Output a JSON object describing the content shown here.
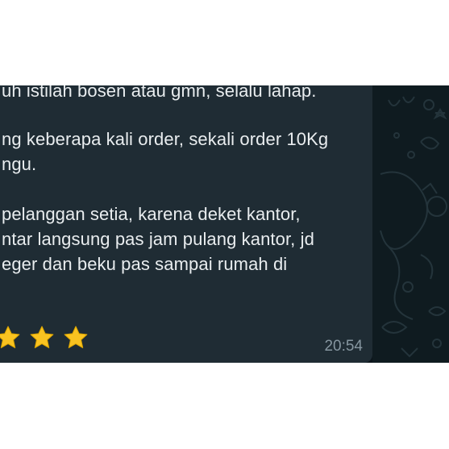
{
  "colors": {
    "bubble_bg": "#1f2c34",
    "chat_bg": "#0b141a",
    "text": "#e9edef",
    "timestamp": "#8696a0",
    "star": "#f9c321"
  },
  "message": {
    "lines": [
      "uh istilah bosen atau gmn, selalu lahap.",
      "ng keberapa kali order, sekali order 10Kg",
      "ngu.",
      "pelanggan setia, karena deket kantor,",
      "ntar langsung pas jam pulang kantor, jd",
      "eger dan beku pas sampai rumah di"
    ],
    "rating_stars": 3,
    "time": "20:54"
  }
}
